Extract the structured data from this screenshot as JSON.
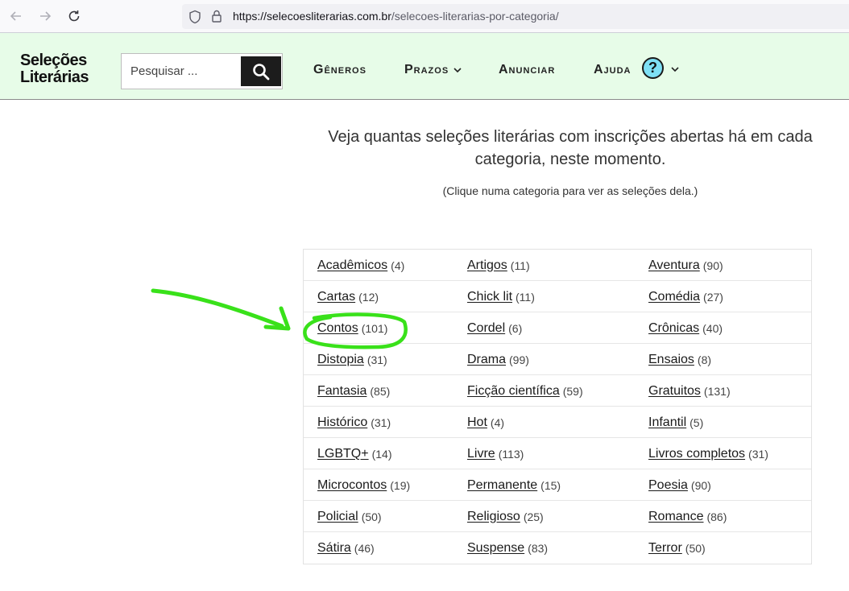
{
  "browser": {
    "url_host": "https://selecoesliterarias.com.br",
    "url_path": "/selecoes-literarias-por-categoria/"
  },
  "header": {
    "logo_line1": "Seleções",
    "logo_line2": "Literárias",
    "search_placeholder": "Pesquisar ...",
    "nav": {
      "generos": "Gêneros",
      "prazos": "Prazos",
      "anunciar": "Anunciar",
      "ajuda": "Ajuda"
    }
  },
  "intro": {
    "line1": "Veja quantas seleções literárias com inscrições abertas há em cada",
    "line2": "categoria, neste momento.",
    "hint": "(Clique numa categoria para ver as seleções dela.)"
  },
  "categories": [
    [
      {
        "label": "Acadêmicos",
        "count": "(4)"
      },
      {
        "label": "Artigos",
        "count": "(11)"
      },
      {
        "label": "Aventura",
        "count": "(90)"
      }
    ],
    [
      {
        "label": "Cartas",
        "count": "(12)"
      },
      {
        "label": "Chick lit",
        "count": "(11)"
      },
      {
        "label": "Comédia",
        "count": "(27)"
      }
    ],
    [
      {
        "label": "Contos",
        "count": "(101)"
      },
      {
        "label": "Cordel",
        "count": "(6)"
      },
      {
        "label": "Crônicas",
        "count": "(40)"
      }
    ],
    [
      {
        "label": "Distopia",
        "count": "(31)"
      },
      {
        "label": "Drama",
        "count": "(99)"
      },
      {
        "label": "Ensaios",
        "count": "(8)"
      }
    ],
    [
      {
        "label": "Fantasia",
        "count": "(85)"
      },
      {
        "label": "Ficção científica",
        "count": "(59)"
      },
      {
        "label": "Gratuitos",
        "count": "(131)"
      }
    ],
    [
      {
        "label": "Histórico",
        "count": "(31)"
      },
      {
        "label": "Hot",
        "count": "(4)"
      },
      {
        "label": "Infantil",
        "count": "(5)"
      }
    ],
    [
      {
        "label": "LGBTQ+",
        "count": "(14)"
      },
      {
        "label": "Livre",
        "count": "(113)"
      },
      {
        "label": "Livros completos",
        "count": "(31)"
      }
    ],
    [
      {
        "label": "Microcontos",
        "count": "(19)"
      },
      {
        "label": "Permanente",
        "count": "(15)"
      },
      {
        "label": "Poesia",
        "count": "(90)"
      }
    ],
    [
      {
        "label": "Policial",
        "count": "(50)"
      },
      {
        "label": "Religioso",
        "count": "(25)"
      },
      {
        "label": "Romance",
        "count": "(86)"
      }
    ],
    [
      {
        "label": "Sátira",
        "count": "(46)"
      },
      {
        "label": "Suspense",
        "count": "(83)"
      },
      {
        "label": "Terror",
        "count": "(50)"
      }
    ]
  ],
  "colors": {
    "header_bg": "#e7fce8",
    "annotation_green": "#39e11a",
    "help_icon_bg": "#7ee0f5"
  }
}
